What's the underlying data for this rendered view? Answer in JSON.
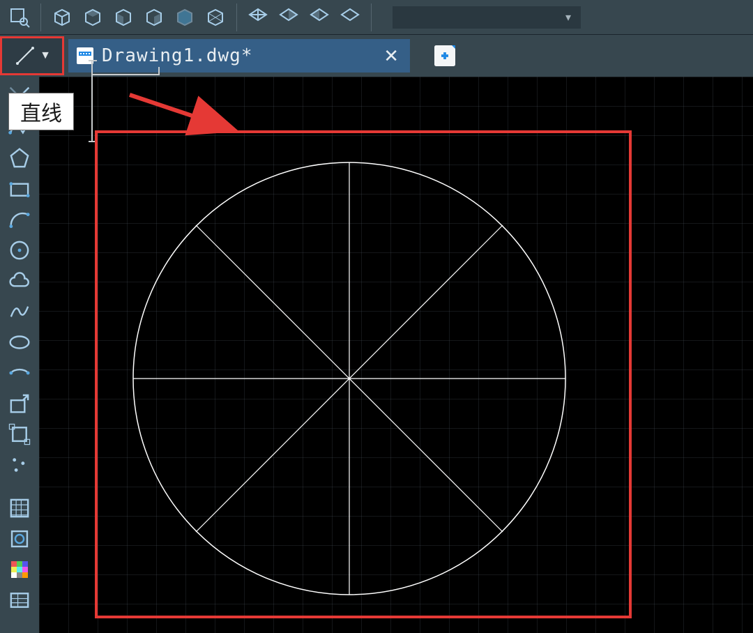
{
  "tab": {
    "icon": "dwg-file-icon",
    "title": "Drawing1.dwg*"
  },
  "tooltip": {
    "line_label": "直线"
  },
  "top_toolbar": {
    "items": [
      "zoom-extents-icon",
      "view-cube-1-icon",
      "view-cube-2-icon",
      "view-cube-3-icon",
      "view-cube-4-icon",
      "view-cube-5-icon",
      "view-cube-6-icon",
      "iso-view-1-icon",
      "iso-view-2-icon",
      "iso-view-3-icon",
      "iso-view-4-icon"
    ]
  },
  "side_toolbar": {
    "items": [
      "construction-line-icon",
      "polyline-icon",
      "polygon-icon",
      "rectangle-icon",
      "arc-icon",
      "circle-icon",
      "cloud-icon",
      "spline-icon",
      "ellipse-icon",
      "ellipse-arc-icon",
      "insert-block-icon",
      "make-block-icon",
      "point-icon",
      "hatch-icon",
      "region-icon",
      "color-palette-icon",
      "table-icon"
    ]
  },
  "drawing": {
    "description": "circle with 8 radial spokes centered, square red highlight frame"
  }
}
